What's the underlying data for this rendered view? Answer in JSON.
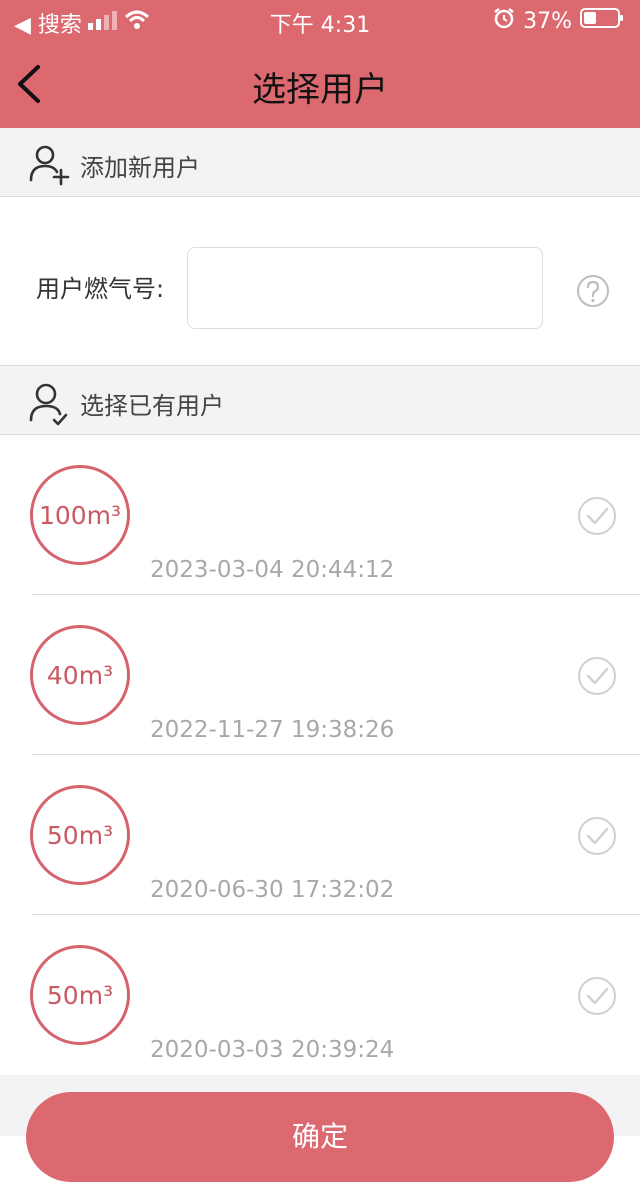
{
  "status_bar": {
    "back_app": "◀ 搜索",
    "time": "下午 4:31",
    "battery": "37%"
  },
  "nav": {
    "title": "选择用户",
    "back_icon": "chevron-left-icon"
  },
  "add_section": {
    "title": "添加新用户",
    "icon": "user-add-icon",
    "field_label": "用户燃气号:",
    "field_value": "",
    "help_icon": "question-circle-icon"
  },
  "select_section": {
    "title": "选择已有用户",
    "icon": "user-check-icon"
  },
  "users": [
    {
      "amount": "100",
      "date": "2023-03-04 20:44:12"
    },
    {
      "amount": "40",
      "date": "2022-11-27 19:38:26"
    },
    {
      "amount": "50",
      "date": "2020-06-30 17:32:02"
    },
    {
      "amount": "50",
      "date": "2020-03-03 20:39:24"
    }
  ],
  "unit": "m³",
  "confirm_label": "确定",
  "colors": {
    "brand": "#dc6870",
    "badge": "#d6636b",
    "date_text": "#a8a8a8",
    "section_bg": "#f3f2f5"
  }
}
